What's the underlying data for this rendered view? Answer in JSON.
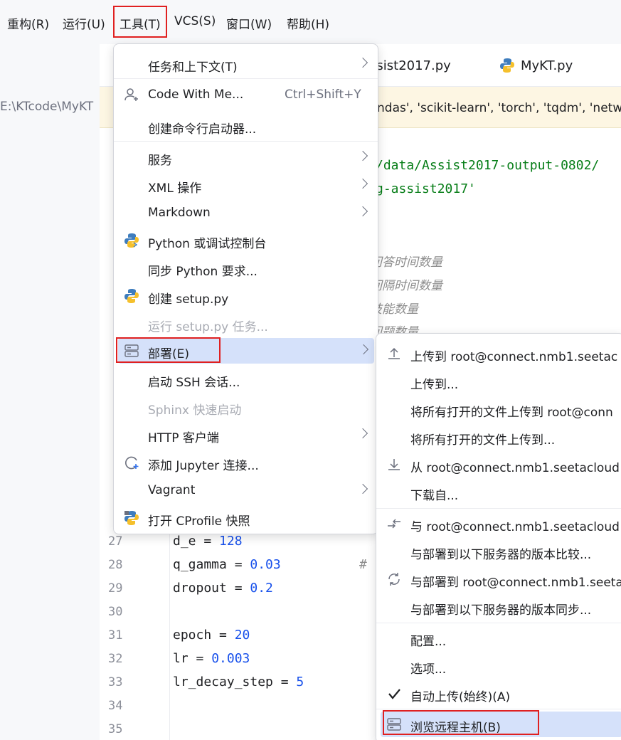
{
  "menubar": {
    "items": [
      "重构(R)",
      "运行(U)",
      "工具(T)",
      "VCS(S)",
      "窗口(W)",
      "帮助(H)"
    ]
  },
  "editor": {
    "path": "E:\\KTcode\\MyKT",
    "tabs": [
      "ssist2017.py",
      "MyKT.py"
    ],
    "notice": "ndas', 'scikit-learn', 'torch', 'tqdm', 'netw",
    "strings": [
      "/data/Assist2017-output-0802/",
      "g-assist2017'"
    ],
    "comments": [
      "问答时间数量",
      "间隔时间数量",
      "技能数量",
      "问题数量"
    ],
    "hash": "#",
    "lines": [
      {
        "n": "27",
        "name": "d_e",
        "val": "128"
      },
      {
        "n": "28",
        "name": "q_gamma",
        "val": "0.03"
      },
      {
        "n": "29",
        "name": "dropout",
        "val": "0.2"
      },
      {
        "n": "30",
        "name": "",
        "val": ""
      },
      {
        "n": "31",
        "name": "epoch",
        "val": "20"
      },
      {
        "n": "32",
        "name": "lr",
        "val": "0.003"
      },
      {
        "n": "33",
        "name": "lr_decay_step",
        "val": "5"
      },
      {
        "n": "34",
        "name": "",
        "val": ""
      },
      {
        "n": "35",
        "name": "",
        "val": ""
      }
    ]
  },
  "tools_menu": {
    "items": [
      {
        "label": "任务和上下文(T)",
        "submenu": true
      },
      {
        "label": "Code With Me...",
        "shortcut": "Ctrl+Shift+Y",
        "icon": "user-plus-icon"
      },
      {
        "label": "创建命令行启动器..."
      },
      {
        "label": "服务",
        "submenu": true
      },
      {
        "label": "XML 操作",
        "submenu": true
      },
      {
        "label": "Markdown",
        "submenu": true
      },
      {
        "label": "Python 或调试控制台",
        "icon": "python-icon"
      },
      {
        "label": "同步 Python 要求..."
      },
      {
        "label": "创建 setup.py",
        "icon": "python-icon"
      },
      {
        "label": "运行 setup.py 任务...",
        "disabled": true
      },
      {
        "label": "部署(E)",
        "submenu": true,
        "selected": true,
        "icon": "server-icon"
      },
      {
        "label": "启动 SSH 会话..."
      },
      {
        "label": "Sphinx 快速启动",
        "disabled": true
      },
      {
        "label": "HTTP 客户端",
        "submenu": true
      },
      {
        "label": "添加 Jupyter 连接...",
        "icon": "jupyter-icon"
      },
      {
        "label": "Vagrant",
        "submenu": true
      },
      {
        "label": "打开 CProfile 快照",
        "icon": "cprofile-icon"
      }
    ]
  },
  "deploy_menu": {
    "items": [
      {
        "label": "上传到 root@connect.nmb1.seetac",
        "icon": "upload-icon"
      },
      {
        "label": "上传到..."
      },
      {
        "label": "将所有打开的文件上传到 root@conn"
      },
      {
        "label": "将所有打开的文件上传到..."
      },
      {
        "label": "从 root@connect.nmb1.seetacloud",
        "icon": "download-icon"
      },
      {
        "label": "下载自..."
      },
      {
        "label": "与 root@connect.nmb1.seetacloud",
        "icon": "compare-icon"
      },
      {
        "label": "与部署到以下服务器的版本比较..."
      },
      {
        "label": "与部署到 root@connect.nmb1.seeta",
        "icon": "sync-icon"
      },
      {
        "label": "与部署到以下服务器的版本同步..."
      },
      {
        "label": "配置..."
      },
      {
        "label": "选项..."
      },
      {
        "label": "自动上传(始终)(A)",
        "icon": "check-icon"
      },
      {
        "label": "浏览远程主机(B)",
        "icon": "server-icon",
        "selected": true
      }
    ]
  },
  "colors": {
    "highlight": "#d5e1fa",
    "redbox": "#e02020",
    "accent": "#1750eb"
  }
}
